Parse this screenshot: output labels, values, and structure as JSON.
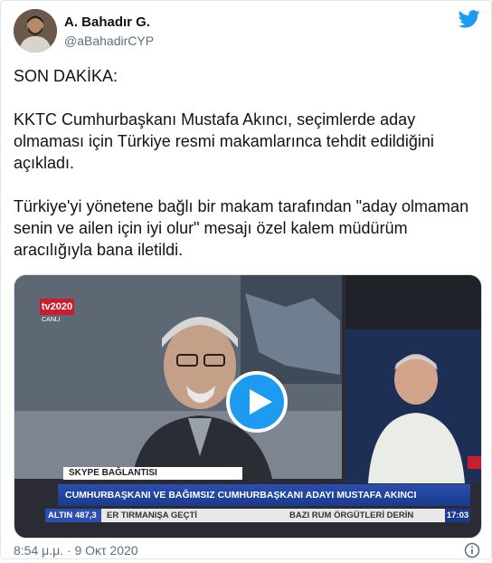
{
  "author": {
    "name": "A. Bahadır G.",
    "handle": "@aBahadirCYP"
  },
  "icons": {
    "brand": "twitter-bird-icon",
    "info": "info-icon",
    "play": "play-icon"
  },
  "colors": {
    "brand": "#1d9bf0",
    "text": "#0f1419",
    "secondary": "#5b7083"
  },
  "tweet": {
    "paragraphs": [
      "SON DAKİKA:",
      "KKTC Cumhurbaşkanı Mustafa Akıncı, seçimlerde aday olmaması için Türkiye resmi makamlarınca tehdit edildiğini açıkladı.",
      "Türkiye'yi yönetene bağlı bir makam tarafından \"aday olmaman senin ve ailen için iyi olur\" mesajı özel kalem müdürüm aracılığıyla bana iletildi."
    ],
    "timestamp": "8:54 μ.μ. · 9 Οκτ 2020"
  },
  "video": {
    "channel_logo": "tv2020",
    "channel_sub": "CANLI",
    "skype_label": "SKYPE BAĞLANTISI",
    "caption": "CUMHURBAŞKANI VE BAĞIMSIZ CUMHURBAŞKANI ADAYI MUSTAFA AKINCI",
    "ticker": {
      "left": "ALTIN 487,3",
      "middle": "ER TIRMANIŞA GEÇTİ",
      "right_text": "BAZI RUM ÖRGÜTLERİ DERİN",
      "time": "17:03"
    }
  }
}
